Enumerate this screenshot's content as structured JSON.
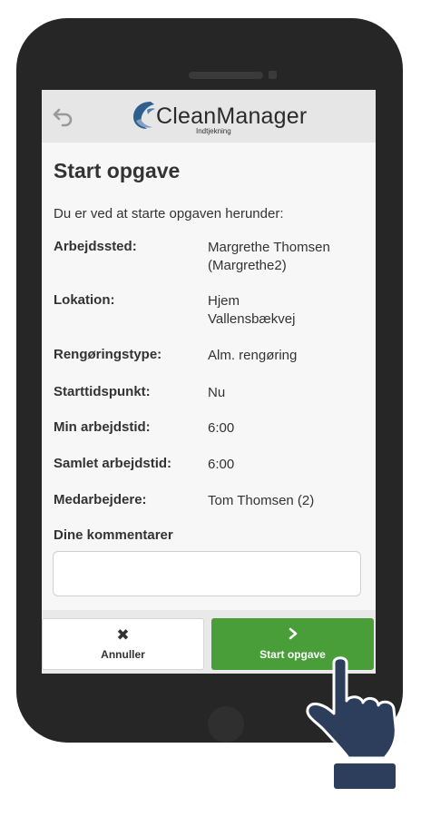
{
  "app": {
    "name": "CleanManager",
    "subtitle": "Indtjekning"
  },
  "page": {
    "title": "Start opgave",
    "intro": "Du er ved at starte opgaven herunder:"
  },
  "details": [
    {
      "label": "Arbejdssted:",
      "value": "Margrethe Thomsen\n(Margrethe2)"
    },
    {
      "label": "Lokation:",
      "value": "Hjem\nVallensbækvej"
    },
    {
      "label": "Rengøringstype:",
      "value": "Alm. rengøring"
    },
    {
      "label": "Starttidspunkt:",
      "value": "Nu"
    },
    {
      "label": "Min arbejdstid:",
      "value": "6:00"
    },
    {
      "label": "Samlet arbejdstid:",
      "value": "6:00"
    },
    {
      "label": "Medarbejdere:",
      "value": "Tom Thomsen (2)"
    }
  ],
  "comments": {
    "label": "Dine kommentarer",
    "value": ""
  },
  "actions": {
    "cancel_label": "Annuller",
    "cancel_icon": "close-icon",
    "start_label": "Start opgave",
    "start_icon": "chevron-right-icon"
  },
  "colors": {
    "accent_green": "#4a9e3a",
    "phone_body": "#262626",
    "topbar": "#e6e6e6",
    "hand": "#2c3e5c"
  }
}
